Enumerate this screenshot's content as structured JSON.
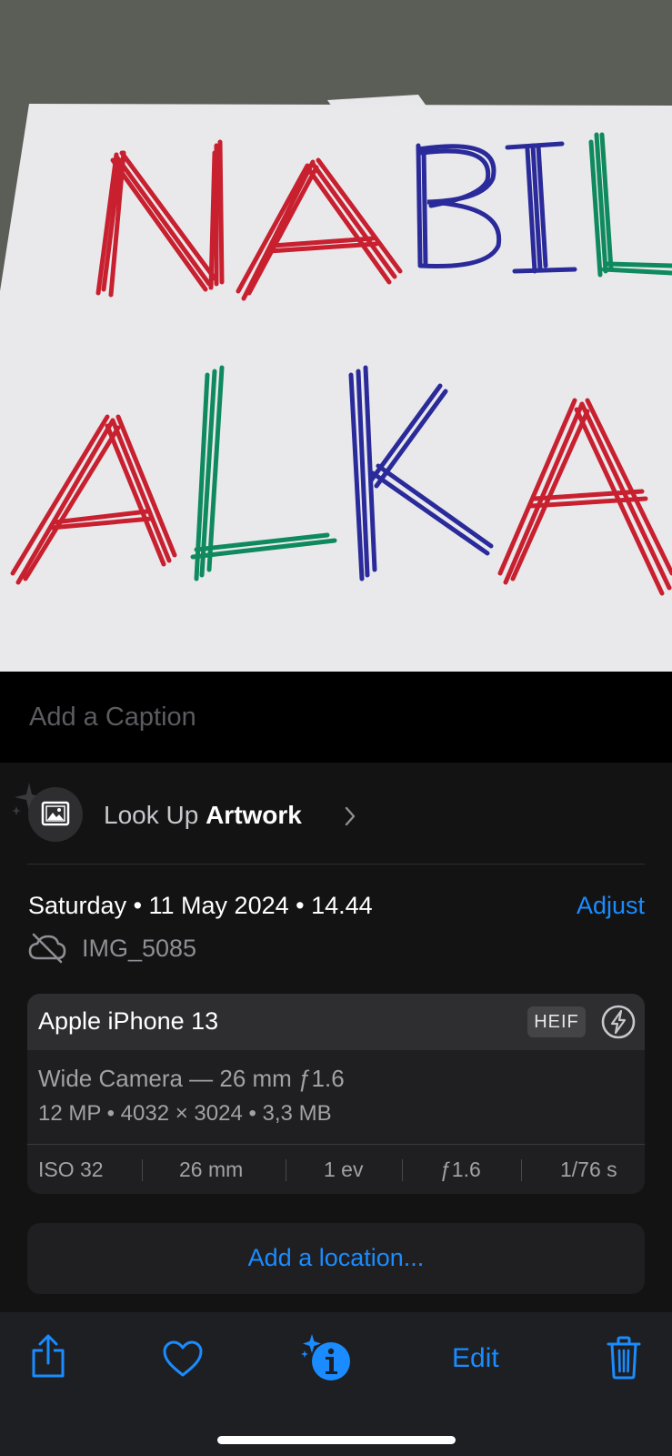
{
  "photo": {
    "line1": [
      "N",
      "A",
      "B",
      "I",
      "L"
    ],
    "line2": [
      "A",
      "L",
      "K",
      "A"
    ],
    "colors": {
      "red": "#c8202f",
      "blue": "#2a2a9a",
      "green": "#0f8a5e"
    }
  },
  "caption": {
    "placeholder": "Add a Caption"
  },
  "lookup": {
    "prefix": "Look Up",
    "subject": "Artwork"
  },
  "meta": {
    "date": "Saturday • 11 May 2024 • 14.44",
    "adjust_label": "Adjust",
    "filename": "IMG_5085"
  },
  "camera": {
    "device": "Apple iPhone 13",
    "format_badge": "HEIF",
    "lens": "Wide Camera — 26 mm ƒ1.6",
    "specs": "12 MP  •  4032 × 3024  •  3,3 MB",
    "exif": {
      "iso": "ISO 32",
      "focal": "26 mm",
      "ev": "1 ev",
      "aperture": "ƒ1.6",
      "shutter": "1/76 s"
    }
  },
  "location": {
    "label": "Add a location..."
  },
  "toolbar": {
    "edit_label": "Edit"
  },
  "accent_color": "#1a8cff"
}
